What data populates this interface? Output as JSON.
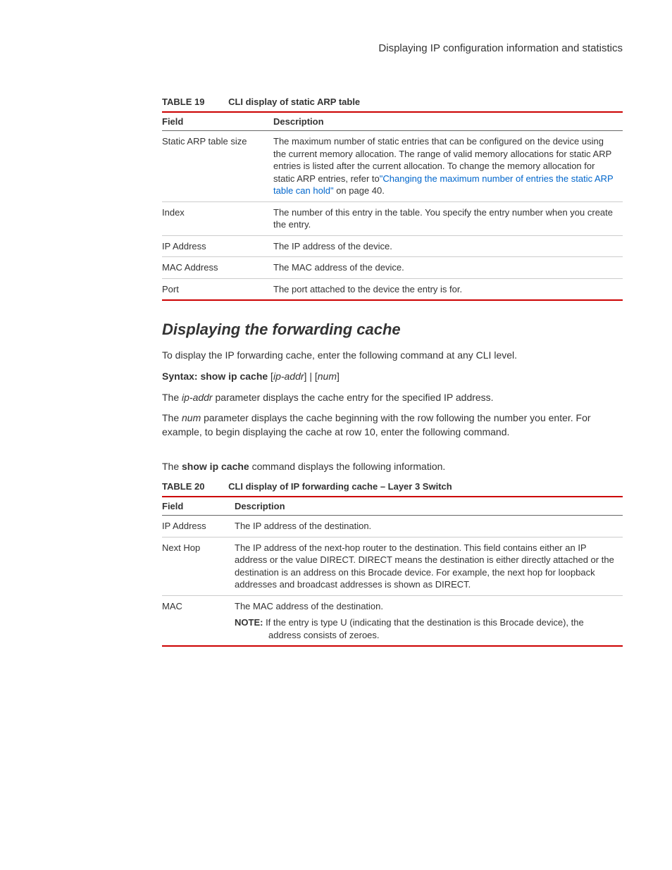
{
  "header": {
    "title": "Displaying IP configuration information and statistics"
  },
  "table19": {
    "number": "TABLE 19",
    "title": "CLI display of static ARP table",
    "headers": {
      "field": "Field",
      "description": "Description"
    },
    "rows": [
      {
        "field": "Static ARP table size",
        "desc_before_link": "The maximum number of static entries that can be configured on the device using the current memory allocation.  The range of valid memory allocations for static ARP entries is listed after the current allocation.  To change the memory allocation for static ARP entries, refer to",
        "link_text": "\"Changing the maximum number of entries the static ARP table can hold\"",
        "desc_after_link": " on page 40."
      },
      {
        "field": "Index",
        "description": "The number of this entry in the table.  You specify the entry number when you create the entry."
      },
      {
        "field": "IP Address",
        "description": "The IP address of the device."
      },
      {
        "field": "MAC Address",
        "description": "The MAC address of the device."
      },
      {
        "field": "Port",
        "description": "The port attached to the device the entry is for."
      }
    ]
  },
  "section": {
    "heading": "Displaying the forwarding cache",
    "intro": "To display the IP forwarding cache, enter the following command at any CLI level.",
    "syntax_label": "Syntax:  ",
    "syntax_cmd": "show ip cache",
    "syntax_args_plain1": " [",
    "syntax_args_ital1": "ip-addr",
    "syntax_args_plain2": "] | [",
    "syntax_args_ital2": "num",
    "syntax_args_plain3": "]",
    "param1_pre": "The ",
    "param1_ital": "ip-addr",
    "param1_post": " parameter displays the cache entry for the specified IP address.",
    "param2_pre": "The ",
    "param2_ital": "num",
    "param2_post": " parameter displays the cache beginning with the row following the number you enter.  For example, to begin displaying the cache at row 10, enter the following command.",
    "follows_pre": "The ",
    "follows_bold": "show ip cache",
    "follows_post": " command displays the following information."
  },
  "table20": {
    "number": "TABLE 20",
    "title": "CLI display of IP forwarding cache – Layer 3 Switch",
    "headers": {
      "field": "Field",
      "description": "Description"
    },
    "rows": [
      {
        "field": "IP Address",
        "description": "The IP address of the destination."
      },
      {
        "field": "Next Hop",
        "description": "The IP address of the next-hop router to the destination.  This field contains either an IP address or the value DIRECT.  DIRECT means the destination is either directly attached or the destination is an address on this Brocade device.  For example, the next hop for loopback addresses and broadcast addresses is shown as DIRECT."
      },
      {
        "field": "MAC",
        "description": "The MAC address of the destination.",
        "note_label": "NOTE:  ",
        "note_text": "If the entry is type U (indicating that the destination is this Brocade device), the address consists of zeroes."
      }
    ]
  }
}
